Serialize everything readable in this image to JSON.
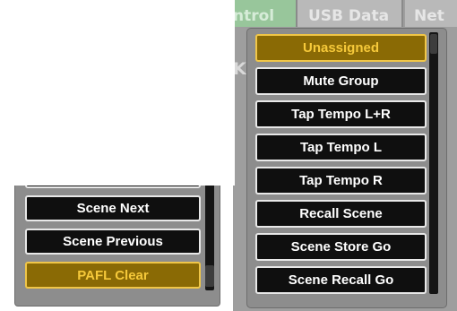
{
  "background": {
    "tabs": [
      {
        "label": "ntrol"
      },
      {
        "label": "USB Data"
      },
      {
        "label": "Net"
      }
    ],
    "partial_label": "Ke"
  },
  "left_list": {
    "items": [
      {
        "label": "Scene Next",
        "selected": false
      },
      {
        "label": "Scene Previous",
        "selected": false
      },
      {
        "label": "PAFL Clear",
        "selected": true
      }
    ]
  },
  "dropdown": {
    "items": [
      {
        "label": "Unassigned",
        "selected": true
      },
      {
        "label": "Mute Group",
        "selected": false
      },
      {
        "label": "Tap Tempo L+R",
        "selected": false
      },
      {
        "label": "Tap Tempo L",
        "selected": false
      },
      {
        "label": "Tap Tempo R",
        "selected": false
      },
      {
        "label": "Recall Scene",
        "selected": false
      },
      {
        "label": "Scene Store Go",
        "selected": false
      },
      {
        "label": "Scene Recall Go",
        "selected": false
      }
    ]
  },
  "colors": {
    "selected_fill": "#8a6a05",
    "selected_border": "#f0c648",
    "selected_text": "#f6c93a",
    "button_fill": "#0f0f0f",
    "panel_grey": "#8d8d8d"
  }
}
